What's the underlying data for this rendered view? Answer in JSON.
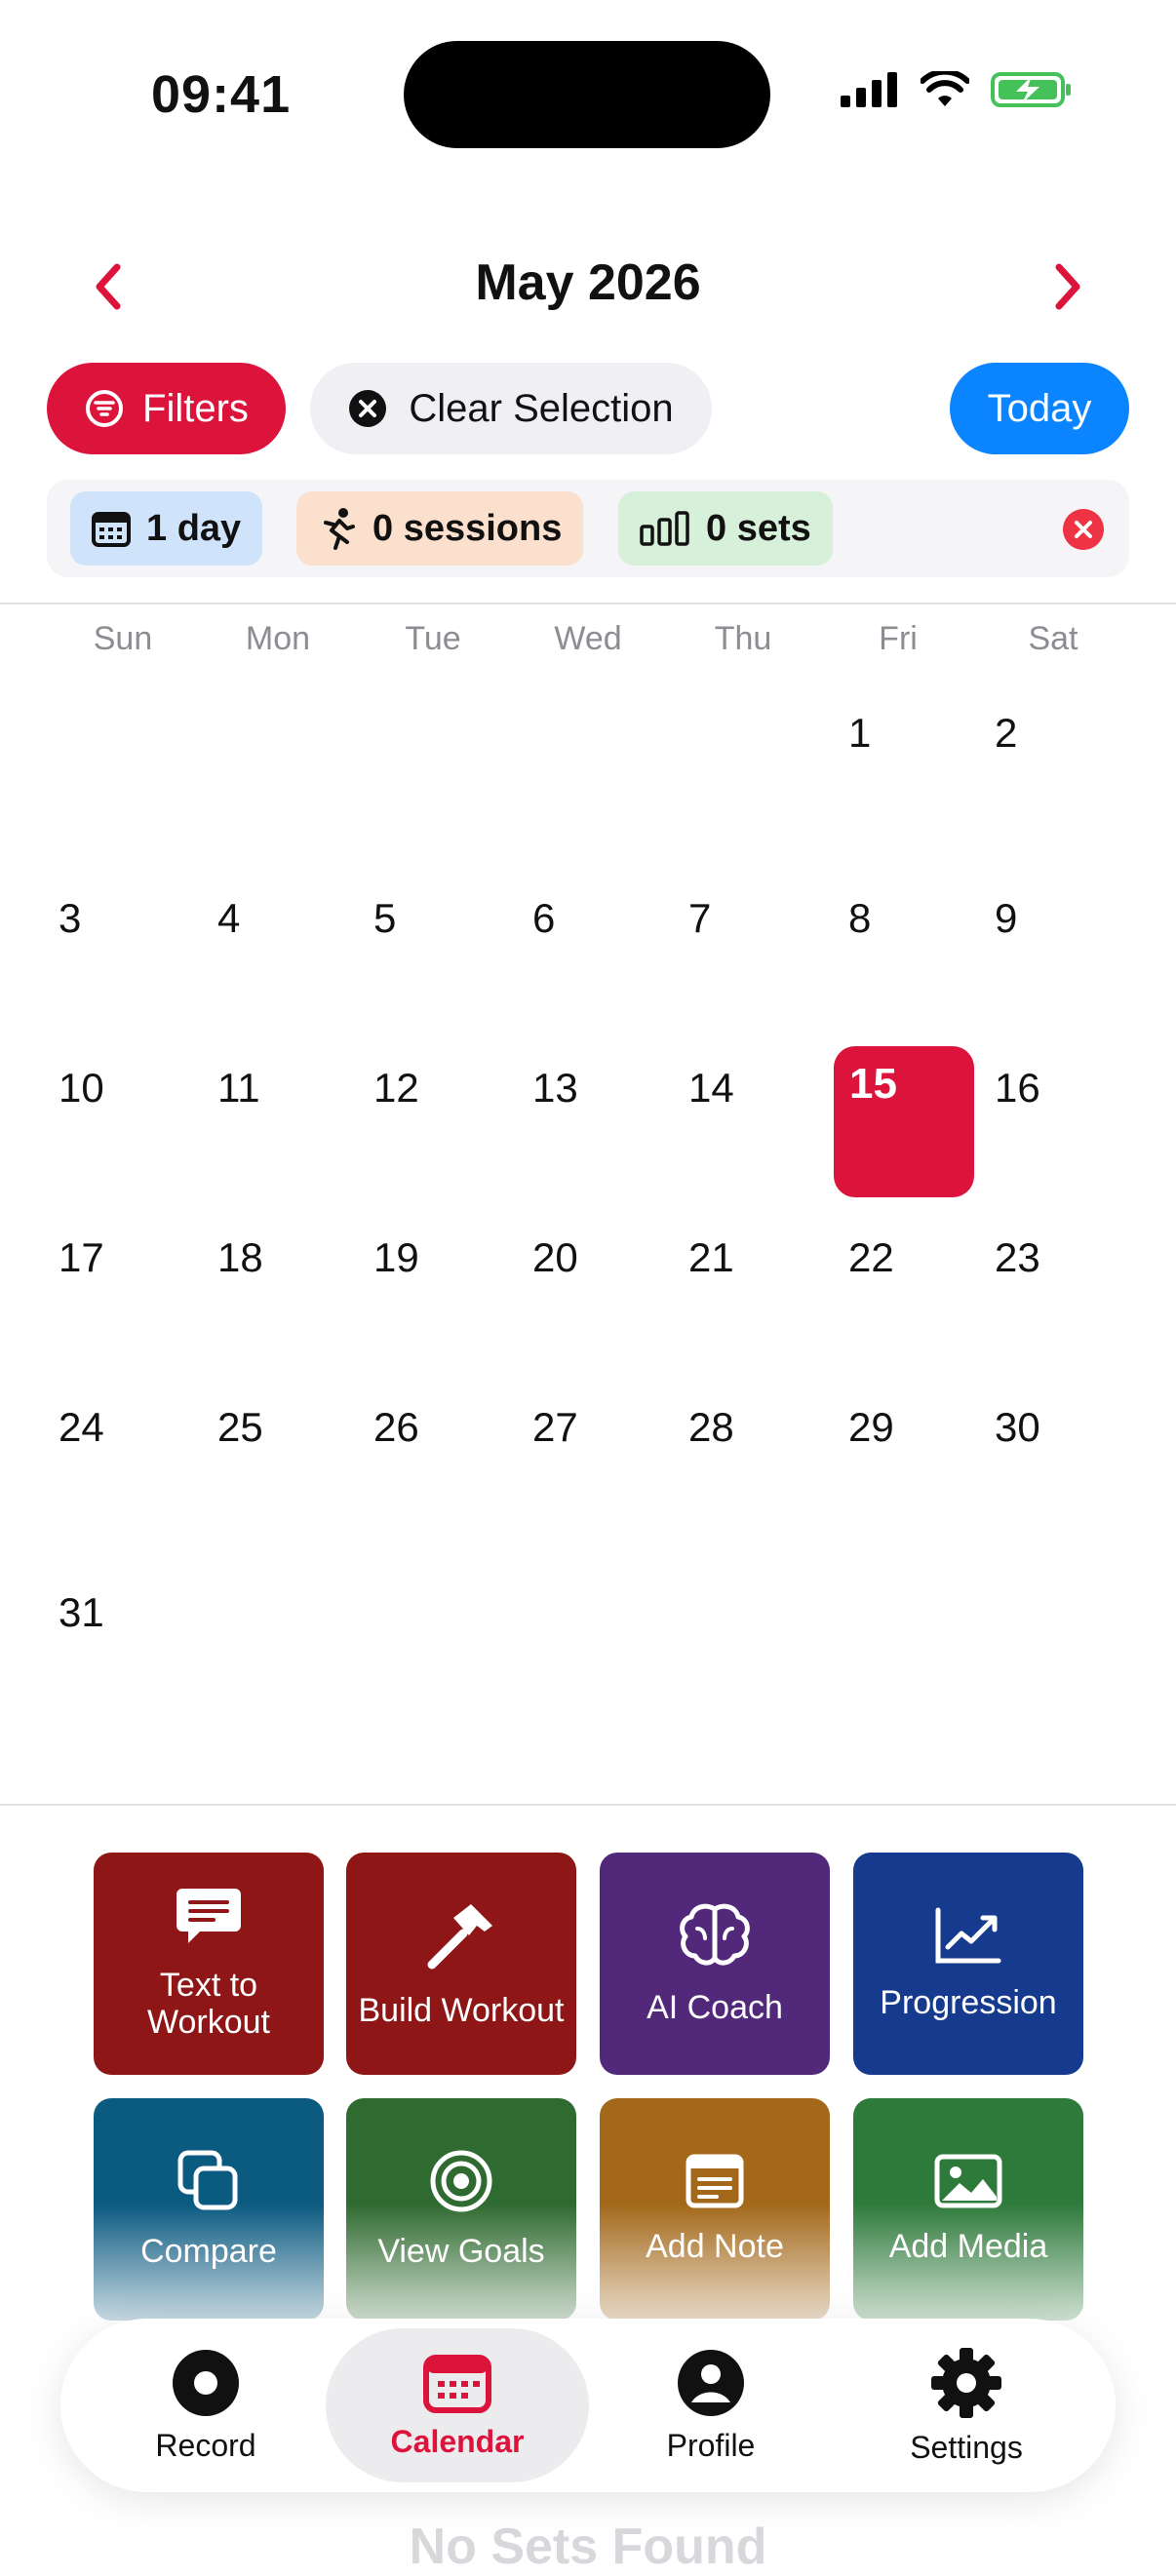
{
  "status_bar": {
    "time": "09:41"
  },
  "calendar": {
    "month_title": "May 2026",
    "weekdays": [
      "Sun",
      "Mon",
      "Tue",
      "Wed",
      "Thu",
      "Fri",
      "Sat"
    ],
    "days": [
      "1",
      "2",
      "3",
      "4",
      "5",
      "6",
      "7",
      "8",
      "9",
      "10",
      "11",
      "12",
      "13",
      "14",
      "15",
      "16",
      "17",
      "18",
      "19",
      "20",
      "21",
      "22",
      "23",
      "24",
      "25",
      "26",
      "27",
      "28",
      "29",
      "30",
      "31"
    ],
    "selected_day": "15"
  },
  "toolbar": {
    "filters_label": "Filters",
    "clear_label": "Clear Selection",
    "today_label": "Today"
  },
  "summary": {
    "days_label": "1 day",
    "sessions_label": "0 sessions",
    "sets_label": "0 sets"
  },
  "actions": [
    {
      "label": "Text to\nWorkout",
      "icon": "message-icon",
      "color": "#8e1616"
    },
    {
      "label": "Build Workout",
      "icon": "hammer-icon",
      "color": "#8e1616"
    },
    {
      "label": "AI Coach",
      "icon": "brain-icon",
      "color": "#52287a"
    },
    {
      "label": "Progression",
      "icon": "chart-line-icon",
      "color": "#163a8e"
    },
    {
      "label": "Compare",
      "icon": "copy-icon",
      "color": "#0b5a80"
    },
    {
      "label": "View Goals",
      "icon": "target-icon",
      "color": "#2f6a30"
    },
    {
      "label": "Add Note",
      "icon": "note-icon",
      "color": "#a3681a"
    },
    {
      "label": "Add Media",
      "icon": "image-icon",
      "color": "#2e7a3b"
    }
  ],
  "empty_state": "No Sets Found",
  "tabbar": {
    "items": [
      {
        "label": "Record",
        "icon": "record-icon"
      },
      {
        "label": "Calendar",
        "icon": "calendar-icon",
        "active": true
      },
      {
        "label": "Profile",
        "icon": "profile-icon"
      },
      {
        "label": "Settings",
        "icon": "gear-icon"
      }
    ]
  },
  "colors": {
    "accent": "#dc143c",
    "today_blue": "#0a84ff"
  }
}
